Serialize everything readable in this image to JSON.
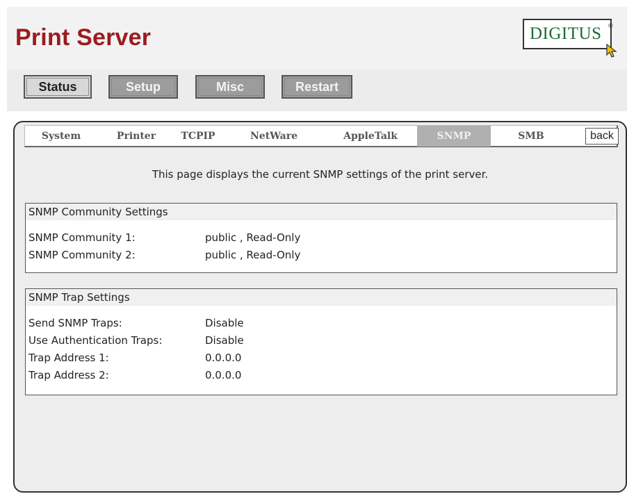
{
  "header": {
    "title": "Print Server",
    "logo_text": "DIGITUS",
    "logo_reg": "®"
  },
  "nav": {
    "status": "Status",
    "setup": "Setup",
    "misc": "Misc",
    "restart": "Restart"
  },
  "tabs": {
    "system": "System",
    "printer": "Printer",
    "tcpip": "TCPIP",
    "netware": "NetWare",
    "appletalk": "AppleTalk",
    "snmp": "SNMP",
    "smb": "SMB",
    "back": "back"
  },
  "intro": "This page displays the current SNMP settings of the print server.",
  "community": {
    "heading": "SNMP Community Settings",
    "rows": [
      {
        "label": "SNMP Community 1:",
        "value": "public , Read-Only"
      },
      {
        "label": "SNMP Community 2:",
        "value": "public , Read-Only"
      }
    ]
  },
  "trap": {
    "heading": "SNMP Trap Settings",
    "rows": [
      {
        "label": "Send SNMP Traps:",
        "value": "Disable"
      },
      {
        "label": "Use Authentication Traps:",
        "value": "Disable"
      },
      {
        "label": "Trap Address 1:",
        "value": "0.0.0.0"
      },
      {
        "label": "Trap Address 2:",
        "value": "0.0.0.0"
      }
    ]
  }
}
